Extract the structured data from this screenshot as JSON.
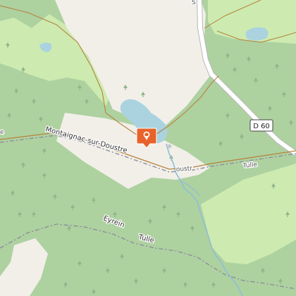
{
  "map": {
    "labels": {
      "village": "Montaignac-sur-Doustre",
      "river_name": "Eyrein",
      "road_name": "Tulle",
      "road_name_right": "Tulle",
      "road_ref": "D 60",
      "partial_left": "e",
      "partial_mid": "oustr",
      "partial_top": "S"
    },
    "marker": {
      "icon": "map-pin-icon",
      "color": "#e8632b"
    },
    "colors": {
      "forest": "#aed1a0",
      "meadow": "#cdebb0",
      "field": "#f2efe9",
      "water": "#aad3df",
      "river": "#8fbfd6",
      "road": "#ffffff",
      "road_casing": "#b8b8b8",
      "track": "#b5833d",
      "boundary": "#8a8a9a",
      "tree_symbol": "#8fb58a"
    }
  }
}
